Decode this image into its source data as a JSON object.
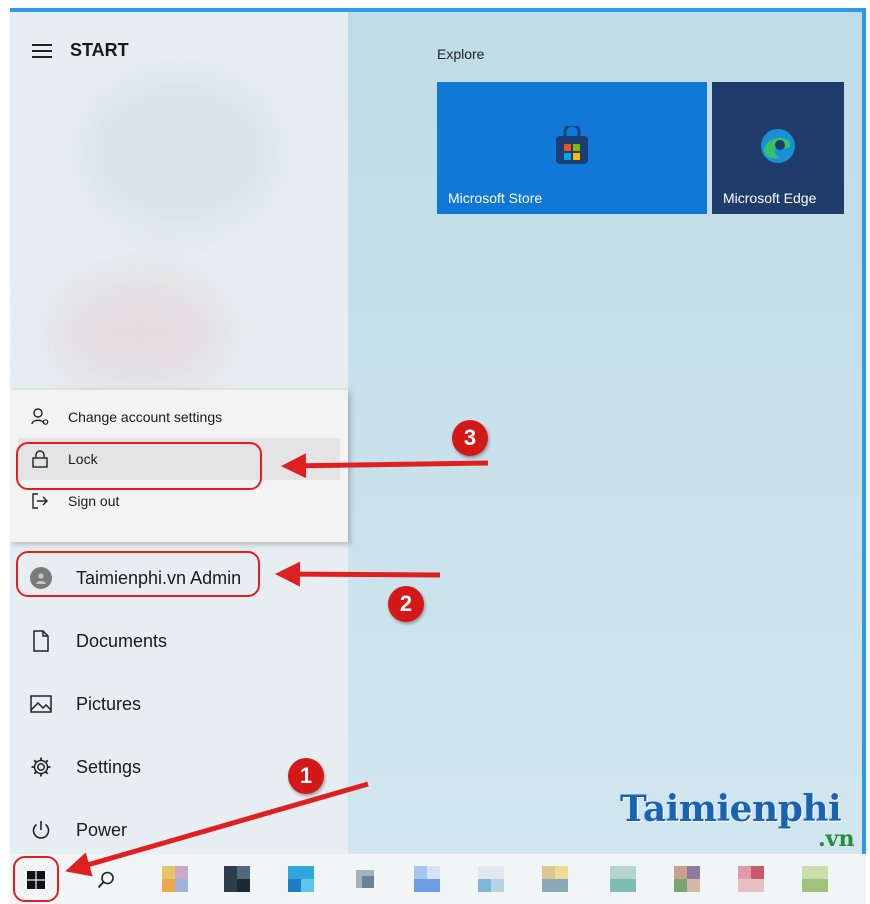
{
  "start_menu": {
    "title": "START",
    "explore_label": "Explore",
    "tiles": [
      {
        "label": "Microsoft Store",
        "color": "#0f79d5"
      },
      {
        "label": "Microsoft Edge",
        "color": "#1f3c6b"
      }
    ]
  },
  "account_popup": {
    "items": [
      {
        "label": "Change account settings",
        "icon": "account-settings-icon"
      },
      {
        "label": "Lock",
        "icon": "lock-icon"
      },
      {
        "label": "Sign out",
        "icon": "sign-out-icon"
      }
    ]
  },
  "user": {
    "name": "Taimienphi.vn Admin"
  },
  "nav": [
    {
      "label": "Documents",
      "icon": "document-icon"
    },
    {
      "label": "Pictures",
      "icon": "pictures-icon"
    },
    {
      "label": "Settings",
      "icon": "gear-icon"
    },
    {
      "label": "Power",
      "icon": "power-icon"
    }
  ],
  "annotations": {
    "step1": "1",
    "step2": "2",
    "step3": "3",
    "highlight_color": "#e02020"
  },
  "watermark": {
    "main": "Taimienphi",
    "tld": ".vn"
  }
}
